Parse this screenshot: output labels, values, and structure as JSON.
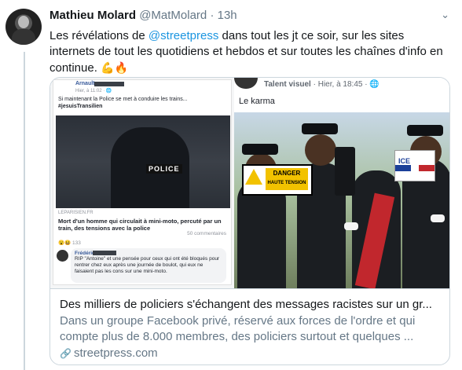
{
  "tweet": {
    "author_name": "Mathieu Molard",
    "author_handle": "@MatMolard",
    "separator": "·",
    "time": "13h",
    "text_before": "Les révélations de ",
    "mention": "@streetpress",
    "text_after": " dans tout les jt ce soir, sur les sites internets de tout les quotidiens et hebdos et sur toutes les chaînes d'info en continue. ",
    "emojis": "💪🔥"
  },
  "card": {
    "left_screenshot": {
      "author": "Arnault",
      "meta": "Hier, à 11:02 · 🌐",
      "text_line1": "Si maintenant la Police se met à conduire les trains...",
      "text_line2": "#jesuisTransilien",
      "photo_tag": "POLICE",
      "link_source": "LEPARISIEN.FR",
      "link_title": "Mort d'un homme qui circulait à mini-moto, percuté par un train, des tensions avec la police",
      "comments_count": "50 commentaires",
      "reactions": "😮😆 133",
      "comment_name": "Frédéric",
      "comment_text": "RIP \"Antoine\" et une pensée pour ceux qui ont été bloqués pour rentrer chez eux après une journée de boulot, qui eux ne faisaient pas les cons sur une mini-moto."
    },
    "right_screenshot": {
      "group": "Talent visuel",
      "meta": "Hier, à 18:45 · 🌐",
      "caption": "Le karma",
      "danger_line1": "DANGER",
      "danger_line2": "HAUTE TENSION",
      "police_car_text": "ICE"
    },
    "title": "Des milliers de policiers s'échangent des messages racistes sur un gr...",
    "description": "Dans un groupe Facebook privé, réservé aux forces de l'ordre et qui compte plus de 8.000 membres, des policiers surtout et quelques ...",
    "domain": "streetpress.com",
    "link_icon": "🔗"
  },
  "icons": {
    "chevron": "⌄"
  }
}
